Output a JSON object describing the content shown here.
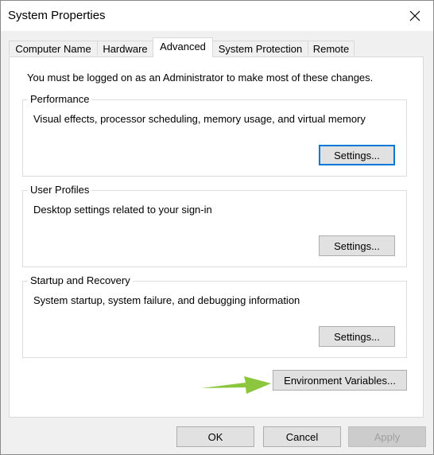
{
  "window": {
    "title": "System Properties"
  },
  "tabs": [
    {
      "label": "Computer Name"
    },
    {
      "label": "Hardware"
    },
    {
      "label": "Advanced"
    },
    {
      "label": "System Protection"
    },
    {
      "label": "Remote"
    }
  ],
  "active_tab": "Advanced",
  "panel": {
    "notice": "You must be logged on as an Administrator to make most of these changes.",
    "groups": [
      {
        "title": "Performance",
        "description": "Visual effects, processor scheduling, memory usage, and virtual memory",
        "button": "Settings..."
      },
      {
        "title": "User Profiles",
        "description": "Desktop settings related to your sign-in",
        "button": "Settings..."
      },
      {
        "title": "Startup and Recovery",
        "description": "System startup, system failure, and debugging information",
        "button": "Settings..."
      }
    ],
    "env_button": "Environment Variables..."
  },
  "footer": {
    "ok": "OK",
    "cancel": "Cancel",
    "apply": "Apply"
  },
  "colors": {
    "focus_border": "#0078d7",
    "arrow": "#8cc63f"
  },
  "icons": {
    "close": "close-icon",
    "pointer": "green-arrow-icon"
  }
}
